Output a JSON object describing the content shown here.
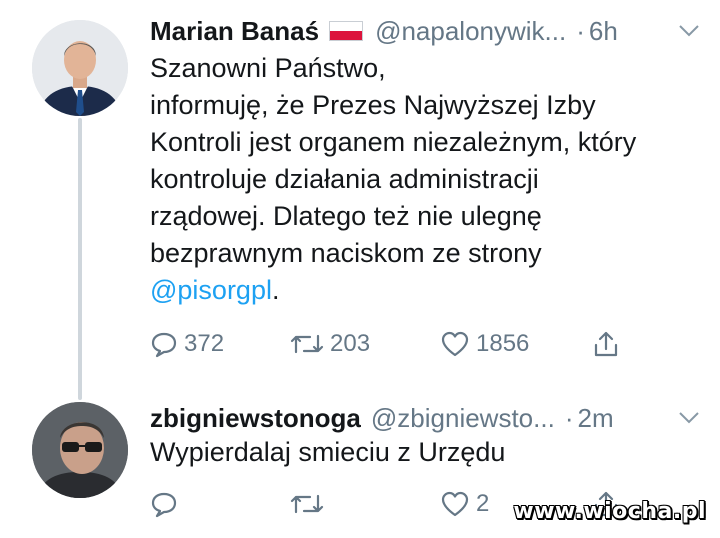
{
  "tweets": [
    {
      "display_name": "Marian Banaś",
      "handle": "@napalonywik...",
      "separator": "·",
      "time": "6h",
      "body_lines": [
        "Szanowni Państwo,",
        "informuję, że Prezes Najwyższej Izby",
        "Kontroli jest organem niezależnym, który",
        "kontroluje działania administracji",
        "rządowej. Dlatego też nie ulegnę",
        "bezprawnym naciskom ze strony"
      ],
      "mention": "@pisorgpl",
      "mention_suffix": ".",
      "replies": "372",
      "retweets": "203",
      "likes": "1856"
    },
    {
      "display_name": "zbigniewstonoga",
      "handle": "@zbigniewsto...",
      "separator": "·",
      "time": "2m",
      "body_lines": [
        "Wypierdalaj smieciu z Urzędu"
      ],
      "replies": "",
      "retweets": "",
      "likes": "2"
    }
  ],
  "watermark": "www.wiocha.pl",
  "colors": {
    "text": "#14171a",
    "muted": "#657786",
    "mention": "#1da1f2",
    "thread_line": "#cfd6dc"
  }
}
